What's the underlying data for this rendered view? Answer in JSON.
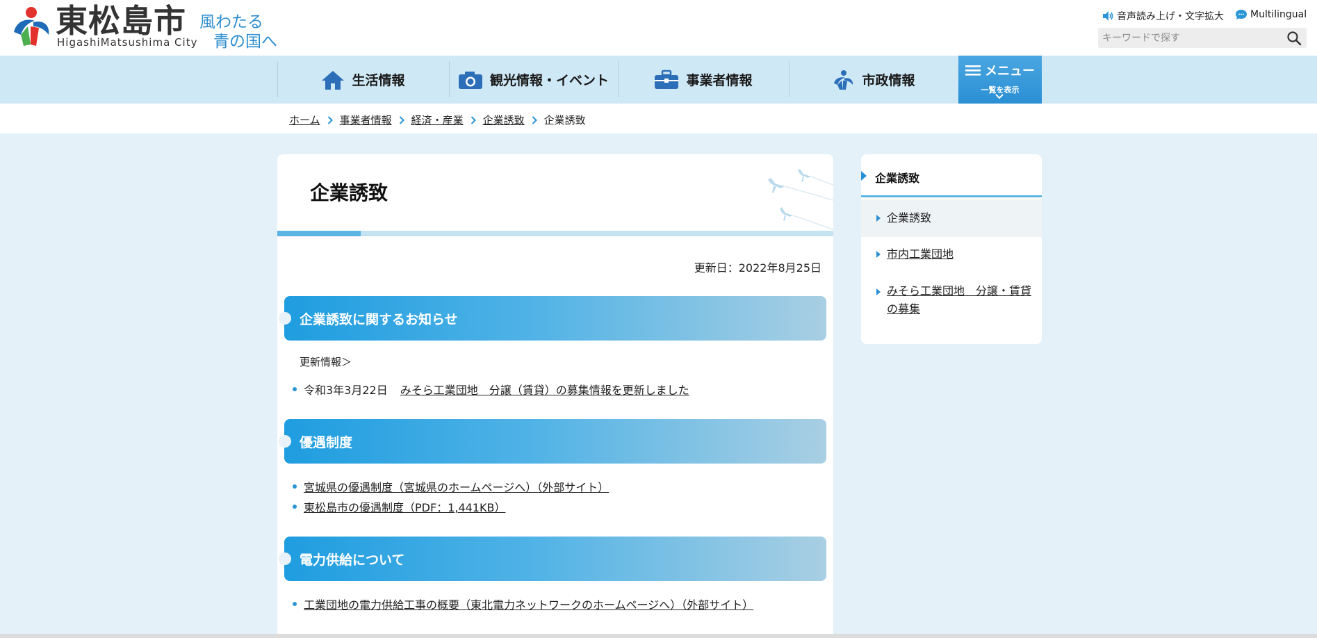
{
  "header": {
    "logo_name": "東松島市",
    "logo_roman": "HigashiMatsushima City",
    "slogan_line1": "風わたる",
    "slogan_line2": "青の国へ",
    "voice_label": "音声読み上げ・文字拡大",
    "lang_label": "Multilingual",
    "search_placeholder": "キーワードで探す"
  },
  "nav": {
    "items": [
      {
        "label": "生活情報",
        "icon": "house-icon"
      },
      {
        "label": "観光情報・イベント",
        "icon": "camera-icon"
      },
      {
        "label": "事業者情報",
        "icon": "briefcase-icon"
      },
      {
        "label": "市政情報",
        "icon": "city-emblem-icon"
      }
    ],
    "menu_label": "メニュー",
    "menu_sub": "一覧を表示"
  },
  "breadcrumb": [
    "ホーム",
    "事業者情報",
    "経済・産業",
    "企業誘致",
    "企業誘致"
  ],
  "main": {
    "title": "企業誘致",
    "updated": "更新日：2022年8月25日",
    "sections": [
      {
        "heading": "企業誘致に関するお知らせ",
        "sub_label": "更新情報＞",
        "links": [
          {
            "prefix": "令和3年3月22日",
            "text": "みそら工業団地　分譲（賃貸）の募集情報を更新しました"
          }
        ]
      },
      {
        "heading": "優遇制度",
        "links": [
          {
            "text": "宮城県の優遇制度（宮城県のホームページへ）（外部サイト）"
          },
          {
            "text": "東松島市の優遇制度（PDF：1,441KB）"
          }
        ]
      },
      {
        "heading": "電力供給について",
        "links": [
          {
            "text": "工業団地の電力供給工事の概要（東北電力ネットワークのホームページへ）（外部サイト）"
          }
        ]
      }
    ]
  },
  "side": {
    "heading": "企業誘致",
    "items": [
      {
        "label": "企業誘致",
        "active": true
      },
      {
        "label": "市内工業団地"
      },
      {
        "label": "みそら工業団地　分譲・賃貸の募集"
      }
    ]
  },
  "colors": {
    "accent": "#2a95d6",
    "nav_bg": "#cfe8f6",
    "page_bg": "#e4f1f8"
  }
}
